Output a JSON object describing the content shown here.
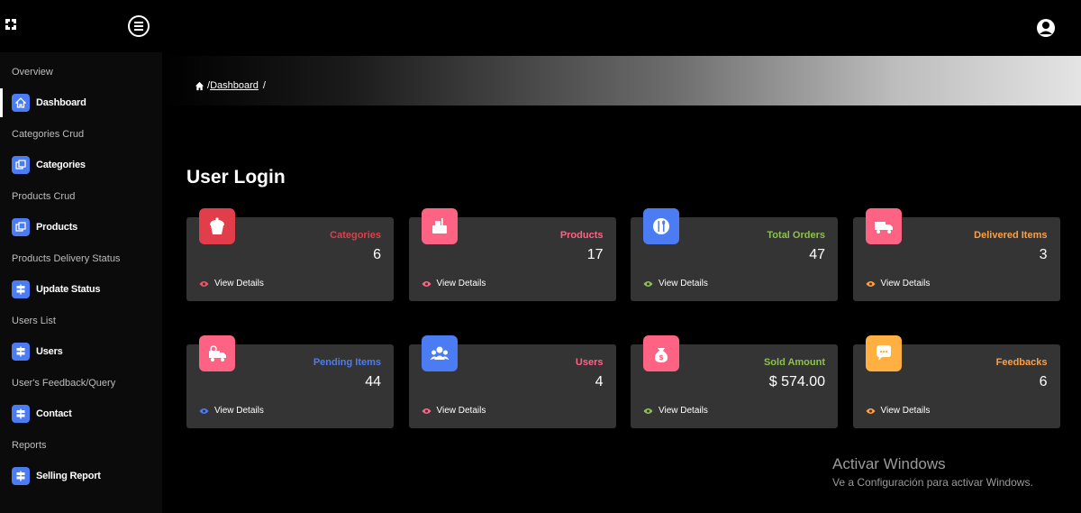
{
  "sidebar": {
    "sections": [
      {
        "title": "Overview",
        "item": {
          "label": "Dashboard",
          "icon": "home-icon"
        }
      },
      {
        "title": "Categories Crud",
        "item": {
          "label": "Categories",
          "icon": "copy-icon"
        }
      },
      {
        "title": "Products Crud",
        "item": {
          "label": "Products",
          "icon": "copy-icon"
        }
      },
      {
        "title": "Products Delivery Status",
        "item": {
          "label": "Update Status",
          "icon": "signpost-icon"
        }
      },
      {
        "title": "Users List",
        "item": {
          "label": "Users",
          "icon": "signpost-icon"
        }
      },
      {
        "title": "User's Feedback/Query",
        "item": {
          "label": "Contact",
          "icon": "signpost-icon"
        }
      },
      {
        "title": "Reports",
        "item": {
          "label": "Selling Report",
          "icon": "signpost-icon"
        }
      }
    ]
  },
  "breadcrumb": {
    "separator": "/",
    "link": "Dashboard",
    "trailing": "/"
  },
  "page": {
    "title": "User Login"
  },
  "cards": [
    {
      "label": "Categories",
      "value": "6",
      "link": "View Details",
      "color": "#e23d4a",
      "icon_bg": "#e23d4a",
      "icon": "cupcake-icon",
      "eye": "#e8576a"
    },
    {
      "label": "Products",
      "value": "17",
      "link": "View Details",
      "color": "#ff6384",
      "icon_bg": "#ff6384",
      "icon": "food-icon",
      "eye": "#ff6384"
    },
    {
      "label": "Total Orders",
      "value": "47",
      "link": "View Details",
      "color": "#8bc34a",
      "icon_bg": "#4c7cf3",
      "icon": "cutlery-icon",
      "eye": "#8bc34a"
    },
    {
      "label": "Delivered Items",
      "value": "3",
      "link": "View Details",
      "color": "#ff9f40",
      "icon_bg": "#ff6384",
      "icon": "truck-icon",
      "eye": "#ff9f40"
    },
    {
      "label": "Pending Items",
      "value": "44",
      "link": "View Details",
      "color": "#4c7cf3",
      "icon_bg": "#ff6384",
      "icon": "delivery-icon",
      "eye": "#4c7cf3"
    },
    {
      "label": "Users",
      "value": "4",
      "link": "View Details",
      "color": "#ff6384",
      "icon_bg": "#4c7cf3",
      "icon": "users-icon",
      "eye": "#ff6384"
    },
    {
      "label": "Sold Amount",
      "value": "$ 574.00",
      "link": "View Details",
      "color": "#8bc34a",
      "icon_bg": "#ff6384",
      "icon": "money-bag-icon",
      "eye": "#8bc34a"
    },
    {
      "label": "Feedbacks",
      "value": "6",
      "link": "View Details",
      "color": "#ff9f40",
      "icon_bg": "#ffb040",
      "icon": "chat-icon",
      "eye": "#ff9f40"
    }
  ],
  "watermark": {
    "title": "Activar Windows",
    "subtitle": "Ve a Configuración para activar Windows."
  }
}
